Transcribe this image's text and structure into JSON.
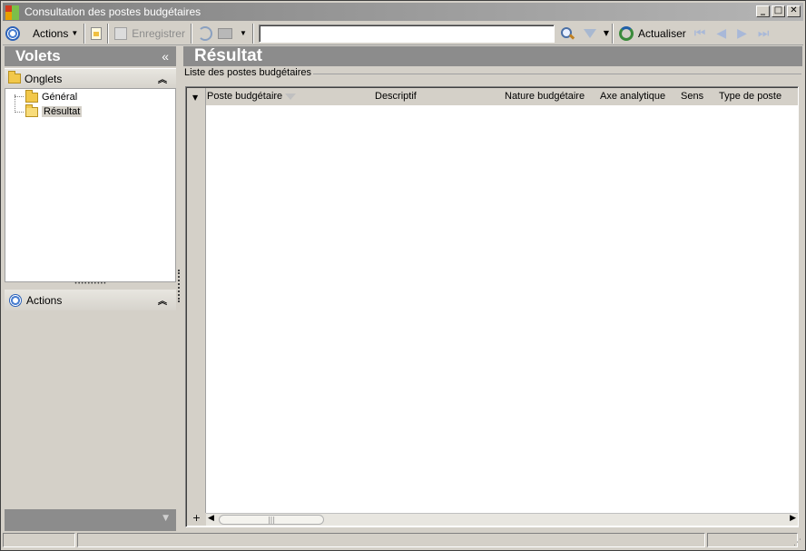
{
  "window": {
    "title": "Consultation des postes budgétaires",
    "controls": [
      "_",
      "□",
      "✕"
    ]
  },
  "toolbar": {
    "actions_label": "Actions",
    "save_label": "Enregistrer",
    "search_value": "",
    "refresh_label": "Actualiser"
  },
  "left_panel": {
    "header": "Volets",
    "collapse_glyph": "«",
    "tabs_section": {
      "label": "Onglets",
      "items": [
        {
          "label": "Général"
        },
        {
          "label": "Résultat",
          "selected": true
        }
      ]
    },
    "actions_section": {
      "label": "Actions"
    }
  },
  "main": {
    "header": "Résultat",
    "group_label": "Liste des postes budgétaires",
    "grid": {
      "columns": [
        "Poste budgétaire",
        "Descriptif",
        "Nature budgétaire",
        "Axe analytique",
        "Sens",
        "Type de poste"
      ],
      "rows": []
    }
  },
  "colors": {
    "panel_header_bg": "#8c8c8c",
    "window_bg": "#d4d0c8",
    "accent_blue": "#2d62b7"
  }
}
